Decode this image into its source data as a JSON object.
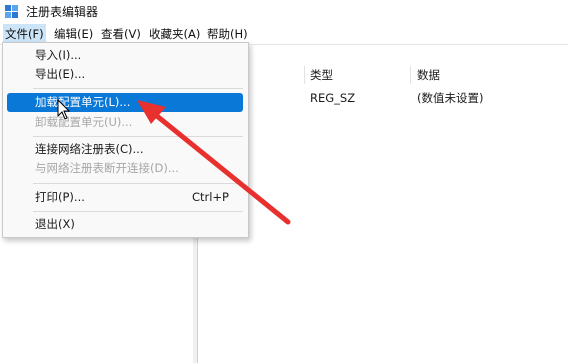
{
  "window": {
    "title": "注册表编辑器"
  },
  "menubar": {
    "file": "文件(F)",
    "edit": "编辑(E)",
    "view": "查看(V)",
    "favorites": "收藏夹(A)",
    "help": "帮助(H)"
  },
  "list": {
    "headers": {
      "type": "类型",
      "data": "数据"
    },
    "rows": [
      {
        "type": "REG_SZ",
        "data": "(数值未设置)"
      }
    ]
  },
  "file_menu": {
    "import": "导入(I)...",
    "export": "导出(E)...",
    "load_hive": "加载配置单元(L)...",
    "unload_hive": "卸载配置单元(U)...",
    "connect": "连接网络注册表(C)...",
    "disconnect": "与网络注册表断开连接(D)...",
    "print": "打印(P)...",
    "print_shortcut": "Ctrl+P",
    "exit": "退出(X)"
  },
  "colors": {
    "highlight": "#0a78d7",
    "annotation_arrow": "#e8302e",
    "menu_active": "#cce4f7"
  }
}
